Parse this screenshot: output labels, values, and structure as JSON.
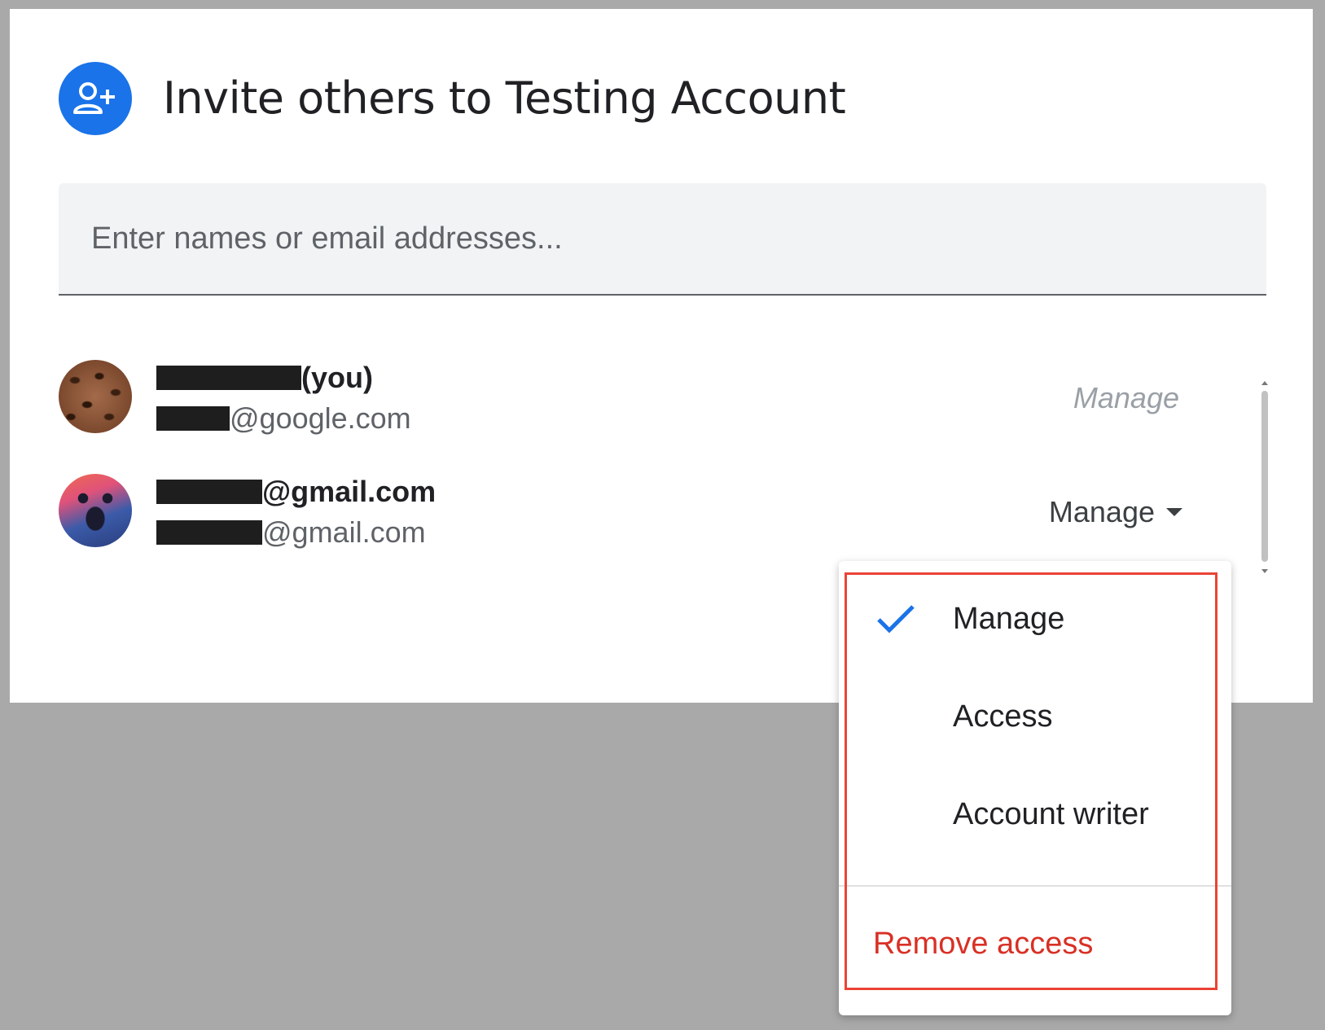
{
  "dialog": {
    "title": "Invite others to Testing Account",
    "header_icon": "person-add-icon",
    "accent_color": "#1a73e8"
  },
  "search": {
    "placeholder": "Enter names or email addresses...",
    "value": ""
  },
  "members": [
    {
      "name_suffix": "(you)",
      "email_suffix": "@google.com",
      "avatar": "coffee-beans-avatar",
      "role_label": "Manage",
      "role_editable": false
    },
    {
      "name_suffix": "@gmail.com",
      "email_suffix": "@gmail.com",
      "avatar": "bear-illustration-avatar",
      "role_label": "Manage",
      "role_editable": true
    }
  ],
  "role_menu": {
    "selected": "Manage",
    "options": [
      "Manage",
      "Access",
      "Account writer"
    ],
    "remove_label": "Remove access",
    "remove_color": "#d93025",
    "highlight_color": "#ea4335"
  }
}
